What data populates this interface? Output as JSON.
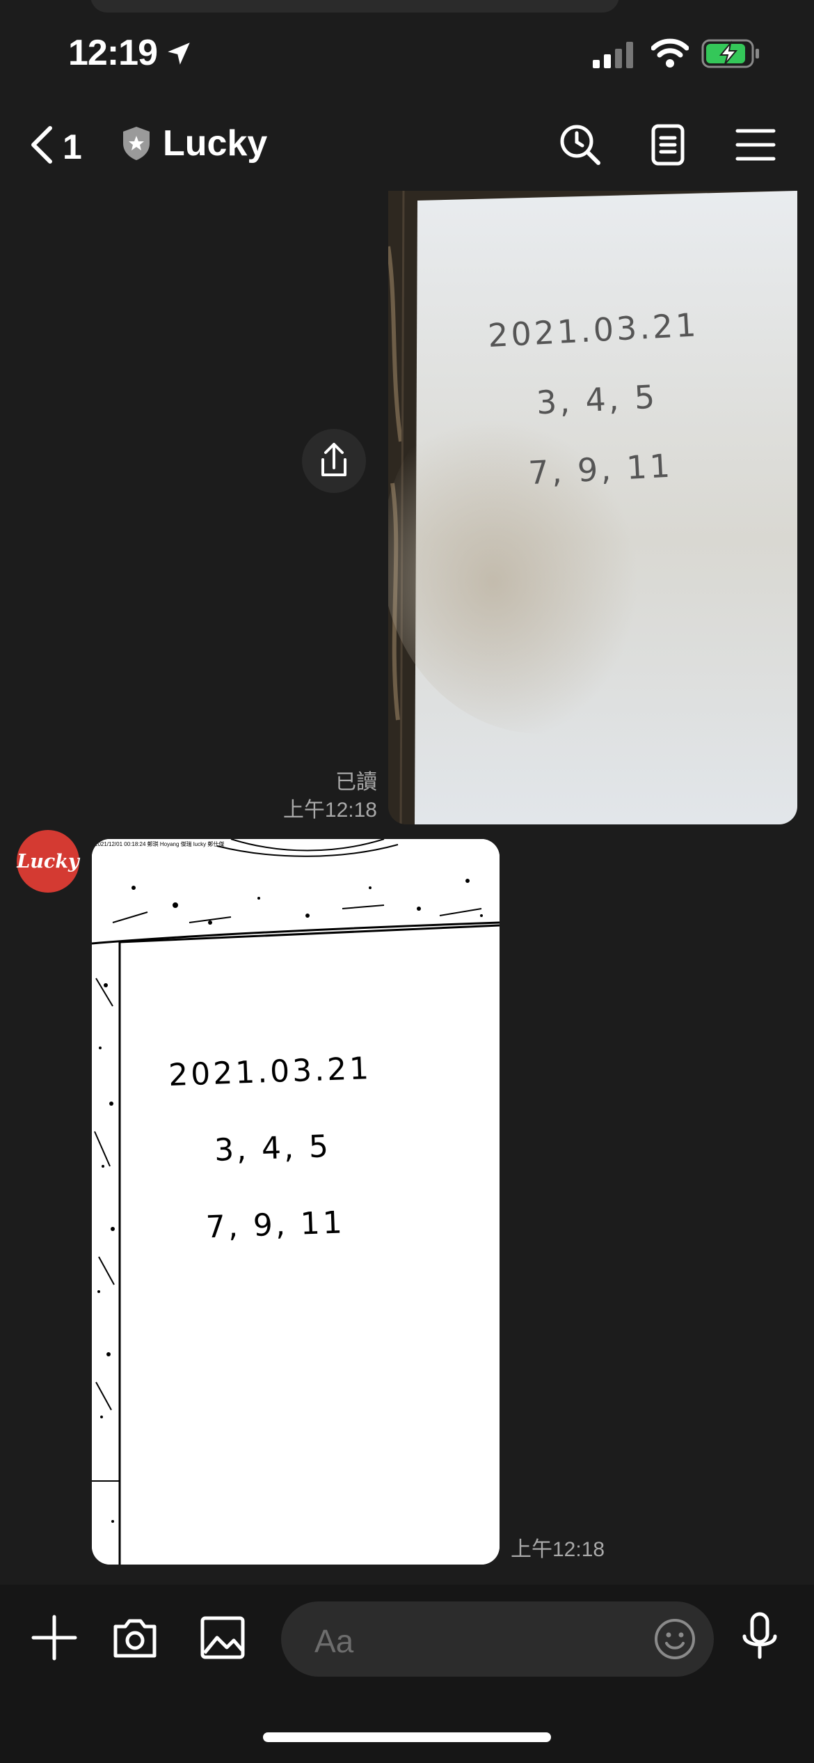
{
  "status_bar": {
    "time": "12:19"
  },
  "header": {
    "back_count": "1",
    "title": "Lucky"
  },
  "messages": {
    "outgoing": {
      "read_label": "已讀",
      "time": "上午12:18",
      "photo_lines": [
        "2021.03.21",
        "3, 4, 5",
        "7, 9, 11"
      ]
    },
    "incoming": {
      "avatar_label": "Lucky",
      "time": "上午12:18",
      "photo_caption": "2021/12/01 00:18:24 鄭琪 Hoyang 傑瑞 lucky 鄭仕傑",
      "photo_lines": [
        "2021.03.21",
        "3, 4, 5",
        "7, 9, 11"
      ]
    }
  },
  "composer": {
    "placeholder": "Aa"
  },
  "icons": [
    "location-arrow-icon",
    "signal-icon",
    "wifi-icon",
    "battery-charging-icon",
    "back-chevron-icon",
    "shield-star-icon",
    "search-history-icon",
    "notes-icon",
    "menu-icon",
    "share-icon",
    "plus-icon",
    "camera-icon",
    "image-icon",
    "emoji-icon",
    "microphone-icon"
  ],
  "colors": {
    "background": "#1c1c1c",
    "battery_green": "#34c759",
    "avatar_red": "#d43a32"
  }
}
